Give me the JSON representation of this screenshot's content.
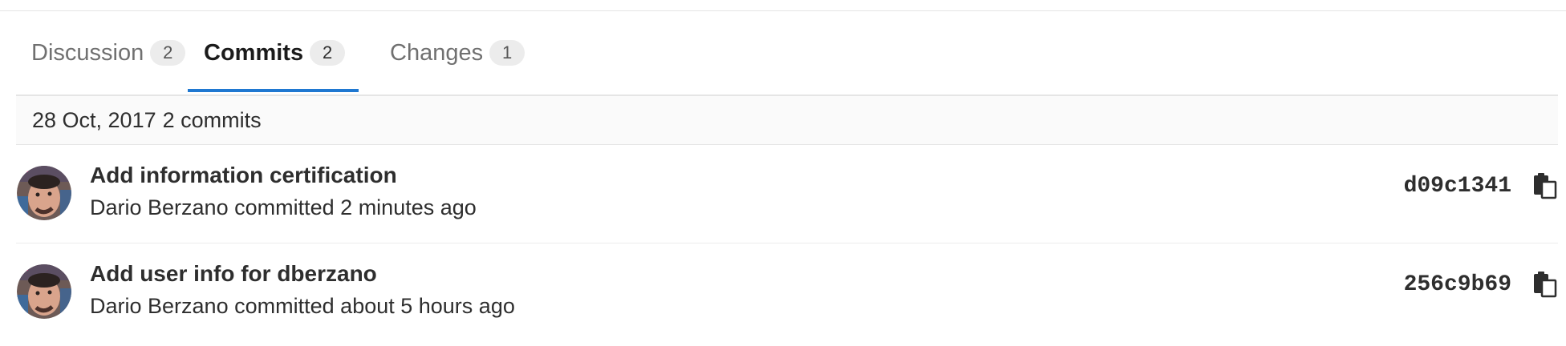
{
  "tabs": [
    {
      "label": "Discussion",
      "count": "2"
    },
    {
      "label": "Commits",
      "count": "2"
    },
    {
      "label": "Changes",
      "count": "1"
    }
  ],
  "active_tab": "Commits",
  "day_group": {
    "date": "28 Oct, 2017",
    "summary": "2 commits"
  },
  "commits": [
    {
      "title": "Add information certification",
      "author": "Dario Berzano",
      "verb": "committed",
      "time": "2 minutes ago",
      "sha": "d09c1341",
      "avatar_icon": "user-avatar",
      "copy_icon": "clipboard-icon"
    },
    {
      "title": "Add user info for dberzano",
      "author": "Dario Berzano",
      "verb": "committed",
      "time": "about 5 hours ago",
      "sha": "256c9b69",
      "avatar_icon": "user-avatar",
      "copy_icon": "clipboard-icon"
    }
  ],
  "colors": {
    "accent": "#1f78d1",
    "badge_bg": "#ececec",
    "header_bg": "#fafafa"
  }
}
